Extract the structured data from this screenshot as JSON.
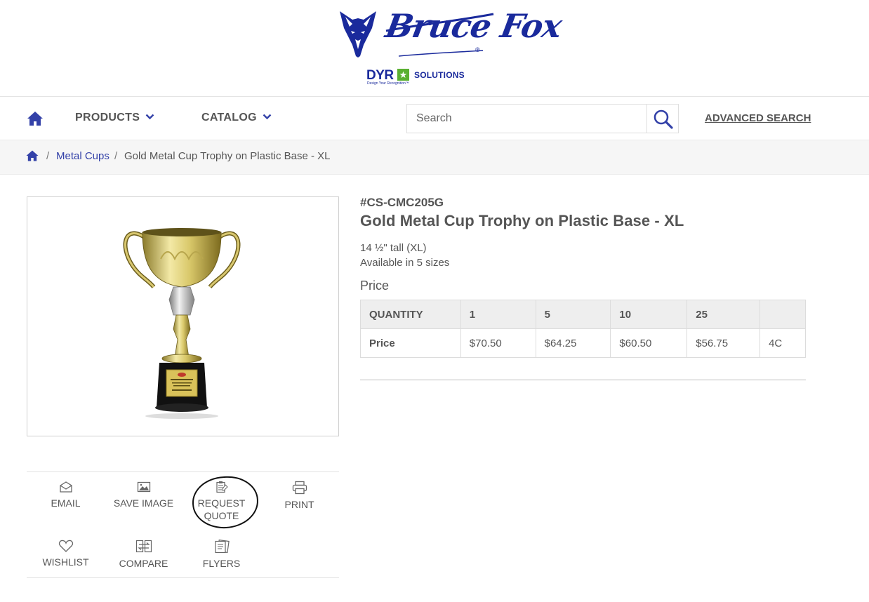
{
  "brand": {
    "name": "Bruce Fox",
    "reg": "®",
    "sub_brand": "DYR",
    "sub_brand_solutions": "SOLUTIONS",
    "sub_brand_tagline": "Design Your Recognition™",
    "color": "#1a2a9c"
  },
  "nav": {
    "products_label": "PRODUCTS",
    "catalog_label": "CATALOG",
    "search_placeholder": "Search",
    "advanced_search_label": "ADVANCED SEARCH",
    "accent": "#3341a8"
  },
  "breadcrumb": {
    "separator": "/",
    "category": "Metal Cups",
    "current": "Gold Metal Cup Trophy on Plastic Base - XL"
  },
  "product": {
    "sku": "#CS-CMC205G",
    "title": "Gold Metal Cup Trophy on Plastic Base - XL",
    "size_text": "14 ½\" tall (XL)",
    "availability": "Available in 5 sizes",
    "price_heading": "Price",
    "image_icon": "trophy-image"
  },
  "price_table": {
    "headers": [
      "QUANTITY",
      "1",
      "5",
      "10",
      "25",
      ""
    ],
    "row_label": "Price",
    "prices": [
      "$70.50",
      "$64.25",
      "$60.50",
      "$56.75",
      "4C"
    ]
  },
  "actions": {
    "email": "EMAIL",
    "save_image": "SAVE IMAGE",
    "request_quote_line1": "REQUEST",
    "request_quote_line2": "QUOTE",
    "print": "PRINT",
    "wishlist": "WISHLIST",
    "compare": "COMPARE",
    "flyers": "FLYERS"
  }
}
